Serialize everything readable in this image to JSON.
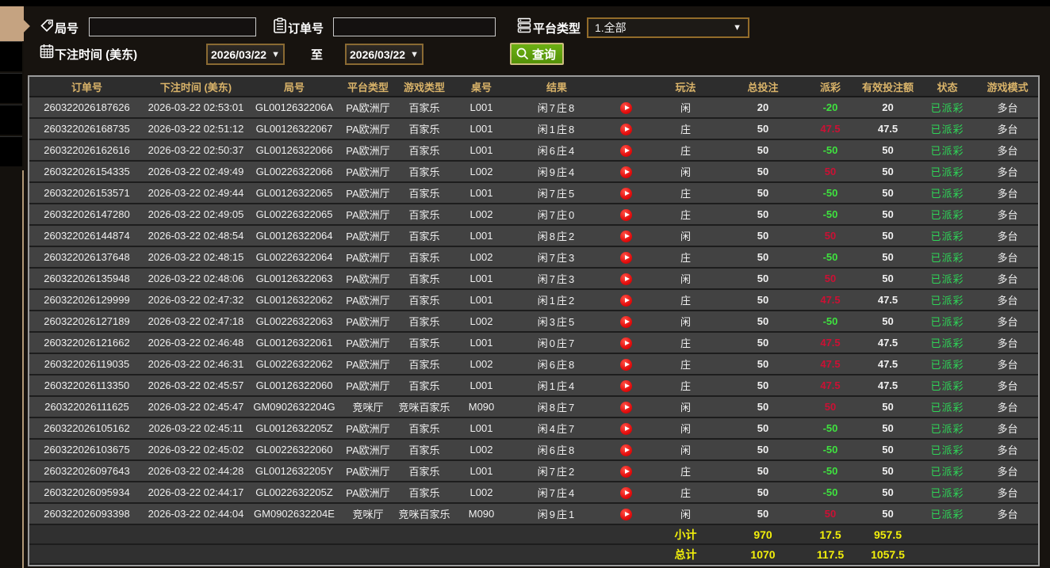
{
  "filters": {
    "round_label": "局号",
    "round_value": "",
    "order_label": "订单号",
    "order_value": "",
    "platform_label": "平台类型",
    "platform_value": "1.全部",
    "bet_time_label": "下注时间 (美东)",
    "date_from": "2026/03/22",
    "to_label": "至",
    "date_to": "2026/03/22",
    "search_label": "查询"
  },
  "table": {
    "headers": {
      "order": "订单号",
      "time": "下注时间 (美东)",
      "round": "局号",
      "platform": "平台类型",
      "game": "游戏类型",
      "table_no": "桌号",
      "result": "结果",
      "play": "玩法",
      "bet": "总投注",
      "payout": "派彩",
      "valid": "有效投注额",
      "status": "状态",
      "mode": "游戏模式"
    },
    "rows": [
      {
        "order": "260322026187626",
        "time": "2026-03-22 02:53:01",
        "round": "GL0012632206A",
        "platform": "PA欧洲厅",
        "game": "百家乐",
        "table_no": "L001",
        "result": "闲7庄8",
        "play": "闲",
        "bet": "20",
        "payout": "-20",
        "valid": "20",
        "status": "已派彩",
        "mode": "多台"
      },
      {
        "order": "260322026168735",
        "time": "2026-03-22 02:51:12",
        "round": "GL00126322067",
        "platform": "PA欧洲厅",
        "game": "百家乐",
        "table_no": "L001",
        "result": "闲1庄8",
        "play": "庄",
        "bet": "50",
        "payout": "47.5",
        "valid": "47.5",
        "status": "已派彩",
        "mode": "多台"
      },
      {
        "order": "260322026162616",
        "time": "2026-03-22 02:50:37",
        "round": "GL00126322066",
        "platform": "PA欧洲厅",
        "game": "百家乐",
        "table_no": "L001",
        "result": "闲6庄4",
        "play": "庄",
        "bet": "50",
        "payout": "-50",
        "valid": "50",
        "status": "已派彩",
        "mode": "多台"
      },
      {
        "order": "260322026154335",
        "time": "2026-03-22 02:49:49",
        "round": "GL00226322066",
        "platform": "PA欧洲厅",
        "game": "百家乐",
        "table_no": "L002",
        "result": "闲9庄4",
        "play": "闲",
        "bet": "50",
        "payout": "50",
        "valid": "50",
        "status": "已派彩",
        "mode": "多台"
      },
      {
        "order": "260322026153571",
        "time": "2026-03-22 02:49:44",
        "round": "GL00126322065",
        "platform": "PA欧洲厅",
        "game": "百家乐",
        "table_no": "L001",
        "result": "闲7庄5",
        "play": "庄",
        "bet": "50",
        "payout": "-50",
        "valid": "50",
        "status": "已派彩",
        "mode": "多台"
      },
      {
        "order": "260322026147280",
        "time": "2026-03-22 02:49:05",
        "round": "GL00226322065",
        "platform": "PA欧洲厅",
        "game": "百家乐",
        "table_no": "L002",
        "result": "闲7庄0",
        "play": "庄",
        "bet": "50",
        "payout": "-50",
        "valid": "50",
        "status": "已派彩",
        "mode": "多台"
      },
      {
        "order": "260322026144874",
        "time": "2026-03-22 02:48:54",
        "round": "GL00126322064",
        "platform": "PA欧洲厅",
        "game": "百家乐",
        "table_no": "L001",
        "result": "闲8庄2",
        "play": "闲",
        "bet": "50",
        "payout": "50",
        "valid": "50",
        "status": "已派彩",
        "mode": "多台"
      },
      {
        "order": "260322026137648",
        "time": "2026-03-22 02:48:15",
        "round": "GL00226322064",
        "platform": "PA欧洲厅",
        "game": "百家乐",
        "table_no": "L002",
        "result": "闲7庄3",
        "play": "庄",
        "bet": "50",
        "payout": "-50",
        "valid": "50",
        "status": "已派彩",
        "mode": "多台"
      },
      {
        "order": "260322026135948",
        "time": "2026-03-22 02:48:06",
        "round": "GL00126322063",
        "platform": "PA欧洲厅",
        "game": "百家乐",
        "table_no": "L001",
        "result": "闲7庄3",
        "play": "闲",
        "bet": "50",
        "payout": "50",
        "valid": "50",
        "status": "已派彩",
        "mode": "多台"
      },
      {
        "order": "260322026129999",
        "time": "2026-03-22 02:47:32",
        "round": "GL00126322062",
        "platform": "PA欧洲厅",
        "game": "百家乐",
        "table_no": "L001",
        "result": "闲1庄2",
        "play": "庄",
        "bet": "50",
        "payout": "47.5",
        "valid": "47.5",
        "status": "已派彩",
        "mode": "多台"
      },
      {
        "order": "260322026127189",
        "time": "2026-03-22 02:47:18",
        "round": "GL00226322063",
        "platform": "PA欧洲厅",
        "game": "百家乐",
        "table_no": "L002",
        "result": "闲3庄5",
        "play": "闲",
        "bet": "50",
        "payout": "-50",
        "valid": "50",
        "status": "已派彩",
        "mode": "多台"
      },
      {
        "order": "260322026121662",
        "time": "2026-03-22 02:46:48",
        "round": "GL00126322061",
        "platform": "PA欧洲厅",
        "game": "百家乐",
        "table_no": "L001",
        "result": "闲0庄7",
        "play": "庄",
        "bet": "50",
        "payout": "47.5",
        "valid": "47.5",
        "status": "已派彩",
        "mode": "多台"
      },
      {
        "order": "260322026119035",
        "time": "2026-03-22 02:46:31",
        "round": "GL00226322062",
        "platform": "PA欧洲厅",
        "game": "百家乐",
        "table_no": "L002",
        "result": "闲6庄8",
        "play": "庄",
        "bet": "50",
        "payout": "47.5",
        "valid": "47.5",
        "status": "已派彩",
        "mode": "多台"
      },
      {
        "order": "260322026113350",
        "time": "2026-03-22 02:45:57",
        "round": "GL00126322060",
        "platform": "PA欧洲厅",
        "game": "百家乐",
        "table_no": "L001",
        "result": "闲1庄4",
        "play": "庄",
        "bet": "50",
        "payout": "47.5",
        "valid": "47.5",
        "status": "已派彩",
        "mode": "多台"
      },
      {
        "order": "260322026111625",
        "time": "2026-03-22 02:45:47",
        "round": "GM0902632204G",
        "platform": "竞咪厅",
        "game": "竞咪百家乐",
        "table_no": "M090",
        "result": "闲8庄7",
        "play": "闲",
        "bet": "50",
        "payout": "50",
        "valid": "50",
        "status": "已派彩",
        "mode": "多台"
      },
      {
        "order": "260322026105162",
        "time": "2026-03-22 02:45:11",
        "round": "GL0012632205Z",
        "platform": "PA欧洲厅",
        "game": "百家乐",
        "table_no": "L001",
        "result": "闲4庄7",
        "play": "闲",
        "bet": "50",
        "payout": "-50",
        "valid": "50",
        "status": "已派彩",
        "mode": "多台"
      },
      {
        "order": "260322026103675",
        "time": "2026-03-22 02:45:02",
        "round": "GL00226322060",
        "platform": "PA欧洲厅",
        "game": "百家乐",
        "table_no": "L002",
        "result": "闲6庄8",
        "play": "闲",
        "bet": "50",
        "payout": "-50",
        "valid": "50",
        "status": "已派彩",
        "mode": "多台"
      },
      {
        "order": "260322026097643",
        "time": "2026-03-22 02:44:28",
        "round": "GL0012632205Y",
        "platform": "PA欧洲厅",
        "game": "百家乐",
        "table_no": "L001",
        "result": "闲7庄2",
        "play": "庄",
        "bet": "50",
        "payout": "-50",
        "valid": "50",
        "status": "已派彩",
        "mode": "多台"
      },
      {
        "order": "260322026095934",
        "time": "2026-03-22 02:44:17",
        "round": "GL0022632205Z",
        "platform": "PA欧洲厅",
        "game": "百家乐",
        "table_no": "L002",
        "result": "闲7庄4",
        "play": "庄",
        "bet": "50",
        "payout": "-50",
        "valid": "50",
        "status": "已派彩",
        "mode": "多台"
      },
      {
        "order": "260322026093398",
        "time": "2026-03-22 02:44:04",
        "round": "GM0902632204E",
        "platform": "竞咪厅",
        "game": "竞咪百家乐",
        "table_no": "M090",
        "result": "闲9庄1",
        "play": "闲",
        "bet": "50",
        "payout": "50",
        "valid": "50",
        "status": "已派彩",
        "mode": "多台"
      }
    ],
    "subtotal": {
      "label": "小计",
      "bet": "970",
      "payout": "17.5",
      "valid": "957.5"
    },
    "total": {
      "label": "总计",
      "bet": "1070",
      "payout": "117.5",
      "valid": "1057.5"
    }
  },
  "colors": {
    "win_red": "#cc1034",
    "loss_green": "#3fe23f",
    "status_green": "#2ed557",
    "total_yellow": "#f2ef0b",
    "header_gold": "#d9b369"
  }
}
